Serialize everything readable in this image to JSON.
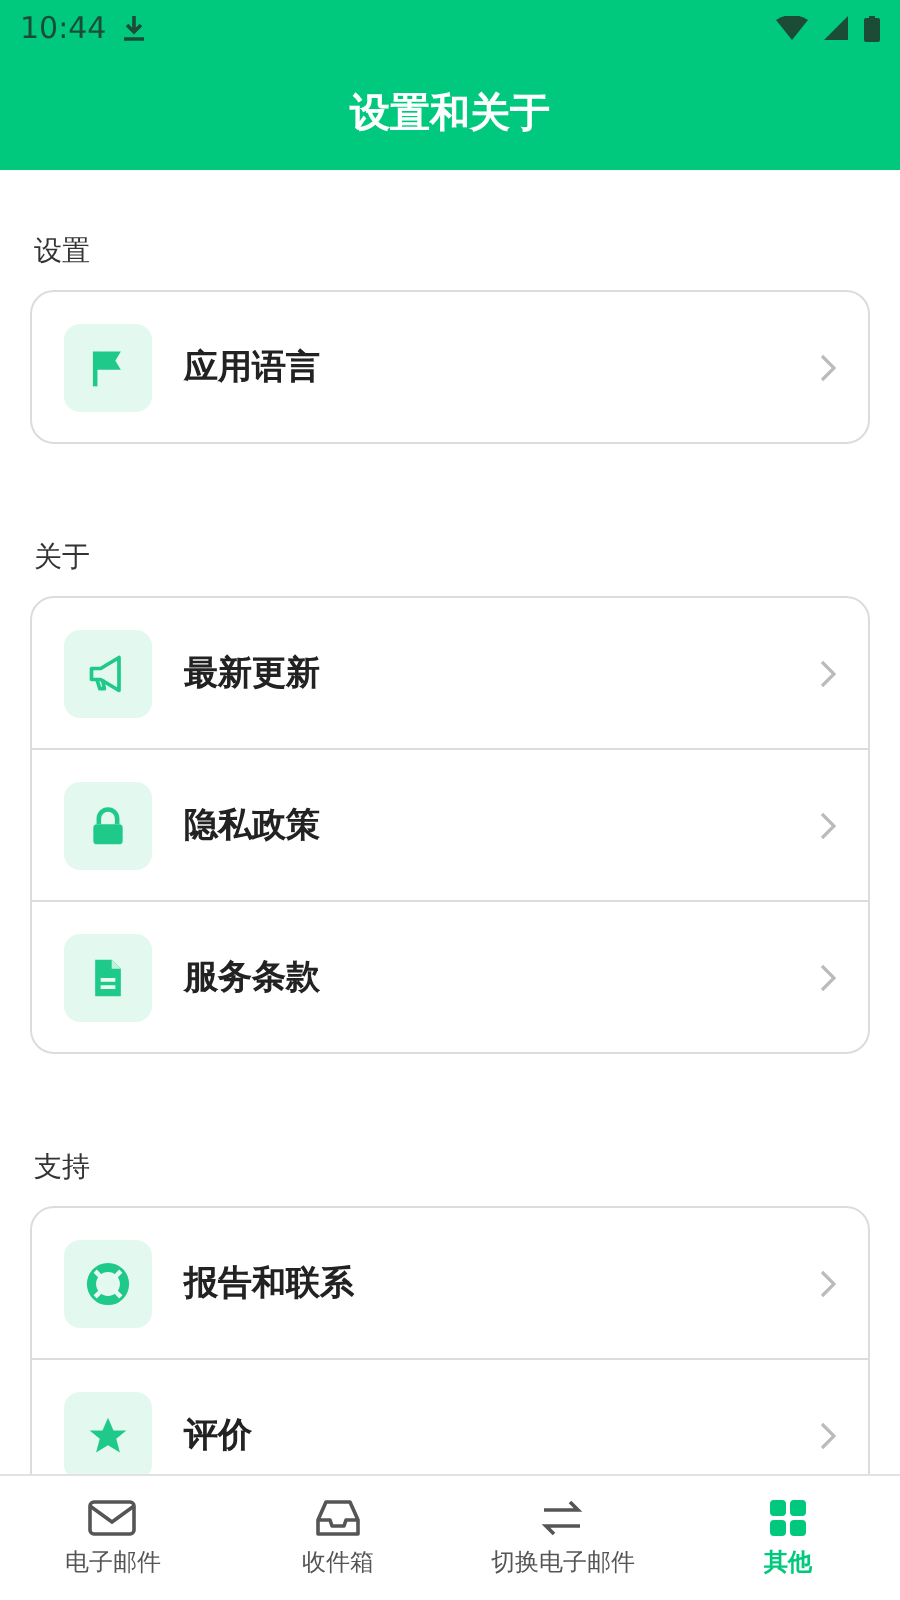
{
  "status_bar": {
    "time": "10:44"
  },
  "header": {
    "title": "设置和关于"
  },
  "sections": [
    {
      "title": "设置",
      "items": [
        {
          "label": "应用语言"
        }
      ]
    },
    {
      "title": "关于",
      "items": [
        {
          "label": "最新更新"
        },
        {
          "label": "隐私政策"
        },
        {
          "label": "服务条款"
        }
      ]
    },
    {
      "title": "支持",
      "items": [
        {
          "label": "报告和联系"
        },
        {
          "label": "评价"
        }
      ]
    }
  ],
  "bottom_nav": [
    {
      "label": "电子邮件",
      "selected": false
    },
    {
      "label": "收件箱",
      "selected": false
    },
    {
      "label": "切换电子邮件",
      "selected": false
    },
    {
      "label": "其他",
      "selected": true
    }
  ]
}
